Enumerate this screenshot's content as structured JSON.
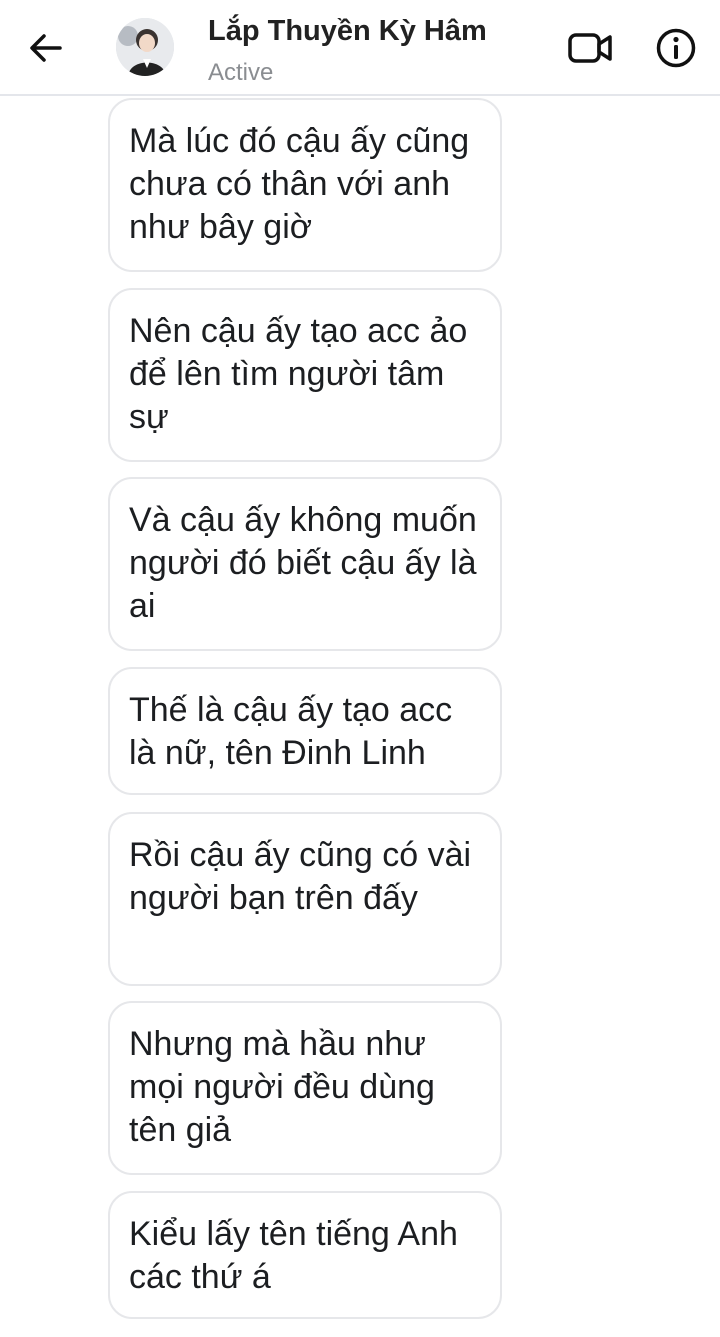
{
  "header": {
    "contact_name": "Lắp Thuyền Kỳ Hâm",
    "status": "Active",
    "icons": {
      "back": "back-arrow-icon",
      "video": "video-camera-icon",
      "info": "info-icon"
    }
  },
  "messages": [
    {
      "text": "Mà lúc đó cậu ấy cũng chưa có thân với anh như bây giờ"
    },
    {
      "text": "Nên cậu ấy tạo acc ảo để lên tìm người tâm sự"
    },
    {
      "text": "Và cậu ấy không muốn người đó biết cậu ấy là ai"
    },
    {
      "text": "Thế là cậu ấy tạo acc là nữ, tên Đinh Linh"
    },
    {
      "text": "Rồi cậu ấy cũng có vài người bạn trên đấy"
    },
    {
      "text": "Nhưng mà hầu như mọi người đều dùng tên giả"
    },
    {
      "text": "Kiểu lấy tên tiếng Anh các thứ á"
    }
  ]
}
